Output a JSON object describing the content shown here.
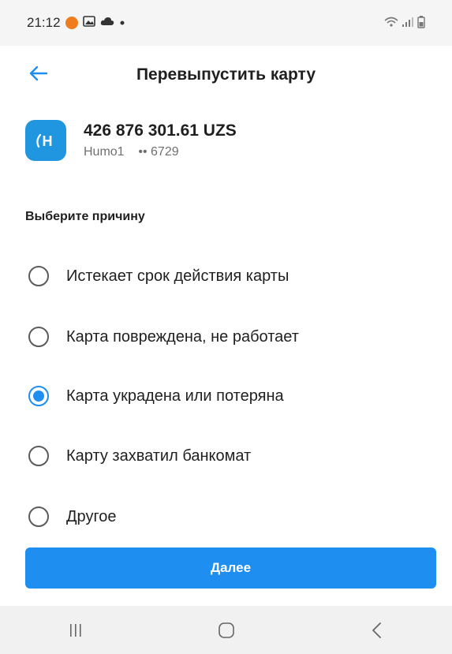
{
  "status_bar": {
    "time": "21:12",
    "icons_left": [
      "app-notification-icon",
      "image-icon",
      "cloud-icon",
      "dot-icon"
    ],
    "icons_right": [
      "wifi-icon",
      "signal-icon",
      "battery-icon"
    ],
    "orange_color": "#ef7d1d"
  },
  "header": {
    "title": "Перевыпустить карту",
    "back_icon": "arrow-left-icon"
  },
  "card": {
    "logo_icon": "humo-logo-icon",
    "logo_letter": "H",
    "balance": "426 876 301.61 UZS",
    "name": "Humo1",
    "masked_number": "•• 6729"
  },
  "reasons": {
    "label": "Выберите причину",
    "options": [
      {
        "label": "Истекает срок действия карты",
        "selected": false
      },
      {
        "label": "Карта повреждена, не работает",
        "selected": false
      },
      {
        "label": "Карта украдена или потеряна",
        "selected": true
      },
      {
        "label": "Карту захватил банкомат",
        "selected": false
      },
      {
        "label": "Другое",
        "selected": false
      }
    ]
  },
  "actions": {
    "next_label": "Далее"
  },
  "nav_bar": {
    "items": [
      "recent-apps-icon",
      "home-icon",
      "back-icon"
    ]
  },
  "colors": {
    "accent": "#1f8ef1",
    "logo_bg": "#2196e0"
  }
}
